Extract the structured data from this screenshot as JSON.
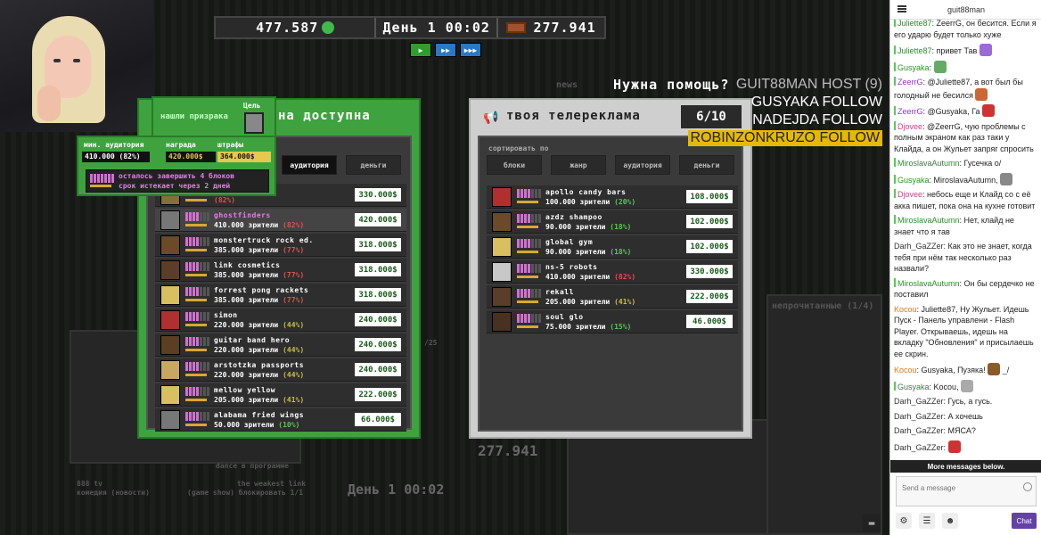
{
  "topbar": {
    "money": "477.587",
    "day_label": "День 1 00:02",
    "box_count": "277.941"
  },
  "goal": {
    "title": "нашли призрака",
    "goal_label": "Цель"
  },
  "requirements": {
    "min_audience_label": "мин. аудитория",
    "reward_label": "награда",
    "penalty_label": "штрафы",
    "min_audience_value": "410.000 (82%)",
    "reward_value": "420.000$",
    "penalty_value": "364.000$",
    "blocks_left": "осталось завершить 4 блоков",
    "deadline": "срок истекает через 2 дней"
  },
  "left_panel": {
    "title": "на доступна",
    "tabs": [
      "аудитория",
      "деньги"
    ],
    "rows": [
      {
        "name": "",
        "viewers": "",
        "pct": "(82%)",
        "price": "330.000$",
        "pct_color": "red",
        "avatar": "#8b6a3c"
      },
      {
        "name": "ghostfinders",
        "viewers": "410.000 зрители",
        "pct": "(82%)",
        "price": "420.000$",
        "pct_color": "red",
        "avatar": "#777777"
      },
      {
        "name": "monstertruck rock ed.",
        "viewers": "385.000 зрители",
        "pct": "(77%)",
        "price": "318.000$",
        "pct_color": "red",
        "avatar": "#6b4a28"
      },
      {
        "name": "link cosmetics",
        "viewers": "385.000 зрители",
        "pct": "(77%)",
        "price": "318.000$",
        "pct_color": "red",
        "avatar": "#5a3e2a"
      },
      {
        "name": "forrest pong rackets",
        "viewers": "385.000 зрители",
        "pct": "(77%)",
        "price": "318.000$",
        "pct_color": "red",
        "avatar": "#d8c060"
      },
      {
        "name": "simon",
        "viewers": "220.000 зрители",
        "pct": "(44%)",
        "price": "240.000$",
        "pct_color": "yellow",
        "avatar": "#b03030"
      },
      {
        "name": "guitar band hero",
        "viewers": "220.000 зрители",
        "pct": "(44%)",
        "price": "240.000$",
        "pct_color": "yellow",
        "avatar": "#5a4020"
      },
      {
        "name": "arstotzka passports",
        "viewers": "220.000 зрители",
        "pct": "(44%)",
        "price": "240.000$",
        "pct_color": "yellow",
        "avatar": "#c8a860"
      },
      {
        "name": "mellow yellow",
        "viewers": "205.000 зрители",
        "pct": "(41%)",
        "price": "222.000$",
        "pct_color": "yellow",
        "avatar": "#d8c060"
      },
      {
        "name": "alabama fried wings",
        "viewers": "50.000 зрители",
        "pct": "(10%)",
        "price": "66.000$",
        "pct_color": "green",
        "avatar": "#777777"
      }
    ]
  },
  "right_panel": {
    "title": "твоя телереклама",
    "counter": "6/10",
    "sort_label": "сортировать по",
    "sort_tabs": [
      "блоки",
      "жанр",
      "аудитория",
      "деньги"
    ],
    "rows": [
      {
        "name": "apollo candy bars",
        "viewers": "100.000 зрители",
        "pct": "(20%)",
        "price": "108.000$",
        "pct_color": "green",
        "avatar": "#b03030"
      },
      {
        "name": "azdz shampoo",
        "viewers": "90.000 зрители",
        "pct": "(18%)",
        "price": "102.000$",
        "pct_color": "green",
        "avatar": "#6b4a28"
      },
      {
        "name": "global gym",
        "viewers": "90.000 зрители",
        "pct": "(18%)",
        "price": "102.000$",
        "pct_color": "green",
        "avatar": "#d8c060"
      },
      {
        "name": "ns-5 robots",
        "viewers": "410.000 зрители",
        "pct": "(82%)",
        "price": "330.000$",
        "pct_color": "red",
        "avatar": "#c8c8c8"
      },
      {
        "name": "rekall",
        "viewers": "205.000 зрители",
        "pct": "(41%)",
        "price": "222.000$",
        "pct_color": "yellow",
        "avatar": "#5a3e2a"
      },
      {
        "name": "soul glo",
        "viewers": "75.000 зрители",
        "pct": "(15%)",
        "price": "46.000$",
        "pct_color": "green",
        "avatar": "#4a3020"
      }
    ]
  },
  "overlay": {
    "help_text": "Нужна помощь?",
    "hosts": [
      "GUIT88MAN HOST (9)",
      "GUSYAKA FOLLOW",
      "NADEJDA FOLLOW",
      "ROBINZONKRUZO FOLLOW"
    ]
  },
  "background": {
    "unread": "непрочитанные (1/4)",
    "money_small": "277.941",
    "day_small": "День 1  00:02",
    "dance": "dance в программе",
    "news": "news",
    "tv1": "888 tv",
    "tv2": "комедия (новости)",
    "weakest": "the weakest link",
    "gameshow": "(game show) блокировать 1/1",
    "fraction": "/25"
  },
  "chat": {
    "channel": "guit88man",
    "messages": [
      {
        "user": "Juliette87",
        "color": "#2e8b2e",
        "text": "ZeerrG, он бесится. Если я его ударю будет только хуже",
        "mod": true
      },
      {
        "user": "Juliette87",
        "color": "#2e8b2e",
        "text": "привет Тав",
        "mod": true,
        "emote": "#9a6bd6"
      },
      {
        "user": "Gusyaka",
        "color": "#2e8b2e",
        "text": "",
        "mod": true,
        "emote": "#66aa66"
      },
      {
        "user": "ZeerrG",
        "color": "#9b30d9",
        "text": "@Juliette87, а вот был бы голодный не бесился",
        "mod": true,
        "emote": "#cc6633"
      },
      {
        "user": "ZeerrG",
        "color": "#9b30d9",
        "text": "@Gusyaka, Га",
        "mod": true,
        "emote": "#cc3333"
      },
      {
        "user": "Djovee",
        "color": "#d23c8c",
        "text": "@ZeerrG, чую проблемы с полным экраном как раз таки у Клайда, а он Жульет запряг спросить",
        "mod": true
      },
      {
        "user": "MiroslavaAutumn",
        "color": "#2e8b2e",
        "text": "Гусечка о/",
        "mod": true
      },
      {
        "user": "Gusyaka",
        "color": "#2e8b2e",
        "text": "MiroslavaAutumn,",
        "mod": true,
        "emote": "#888888"
      },
      {
        "user": "Djovee",
        "color": "#d23c8c",
        "text": "небось еще и Клайд со с её акка пишет, пока она на кухне готовит",
        "mod": true
      },
      {
        "user": "MiroslavaAutumn",
        "color": "#2e8b2e",
        "text": "Нет, клайд не знает что я тав",
        "mod": true
      },
      {
        "user": "Darh_GaZZer",
        "color": "#333333",
        "text": "Как это не знает, когда тебя при нём так несколько раз назвали?",
        "mod": false
      },
      {
        "user": "MiroslavaAutumn",
        "color": "#2e8b2e",
        "text": "Он бы сердечко не поставил",
        "mod": true
      },
      {
        "user": "Kocou",
        "color": "#e07a10",
        "text": "Juliette87, Ну Жульет. Идешь Пуск - Панель управлени - Flash Player. Открываешь, идешь на вкладку \"Обновления\" и присылаешь ее скрин.",
        "mod": false
      },
      {
        "user": "Kocou",
        "color": "#e07a10",
        "text": "Gusyaka, Пузяка!",
        "mod": false,
        "emote": "#8b5a2b",
        "suffix": " _/"
      },
      {
        "user": "Gusyaka",
        "color": "#2e8b2e",
        "text": "Kocou,",
        "mod": true,
        "emote": "#aaaaaa"
      },
      {
        "user": "Darh_GaZZer",
        "color": "#333333",
        "text": "Гусь, а гусь.",
        "mod": false
      },
      {
        "user": "Darh_GaZZer",
        "color": "#333333",
        "text": "А хочешь",
        "mod": false
      },
      {
        "user": "Darh_GaZZer",
        "color": "#333333",
        "text": "МЯСА?",
        "mod": false
      },
      {
        "user": "Darh_GaZZer",
        "color": "#333333",
        "text": "",
        "mod": false,
        "emote": "#cc3333"
      }
    ],
    "more_messages": "More messages below.",
    "input_placeholder": "Send a message",
    "chat_button": "Chat"
  }
}
